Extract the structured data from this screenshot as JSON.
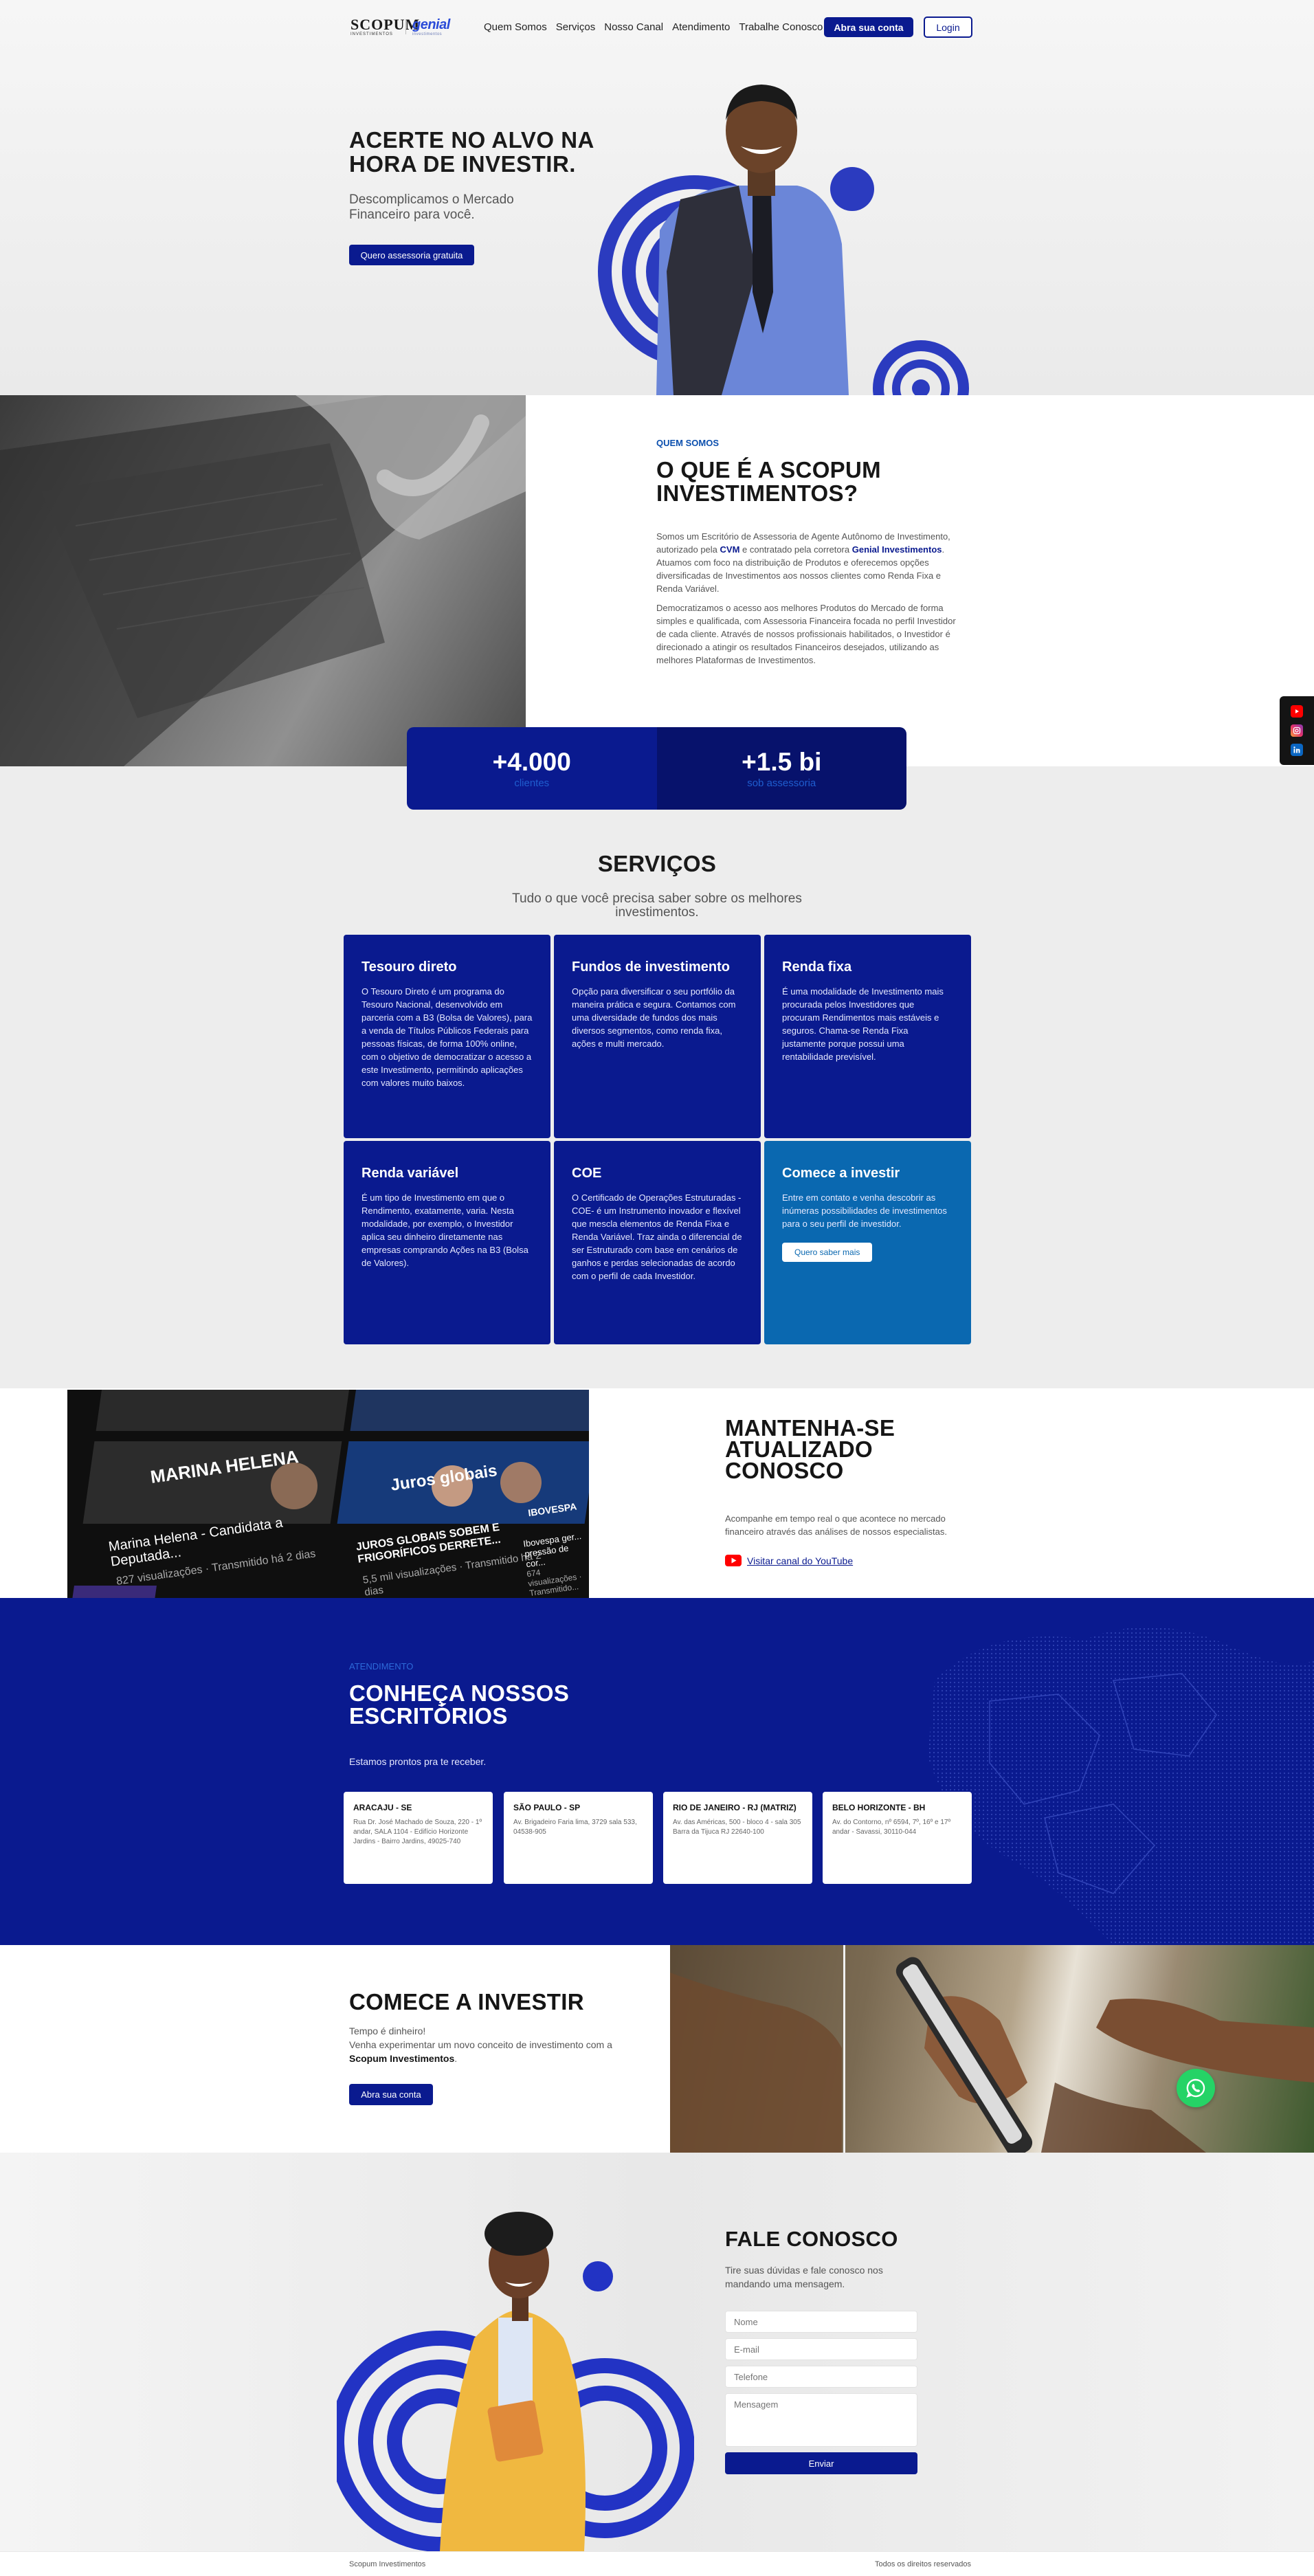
{
  "header": {
    "logo_scopum": "SCOPUM",
    "logo_scopum_sub": "INVESTIMENTOS",
    "logo_genial": "genial",
    "logo_genial_sub": "investimentos",
    "nav": [
      "Quem Somos",
      "Serviços",
      "Nosso Canal",
      "Atendimento",
      "Trabalhe Conosco"
    ],
    "open_account": "Abra sua conta",
    "login": "Login"
  },
  "hero": {
    "title_pre": "ACERTE NO ",
    "title_bold": "ALVO",
    "title_post": " NA HORA DE INVESTIR.",
    "subtitle": "Descomplicamos o Mercado Financeiro para você.",
    "cta": "Quero assessoria gratuita"
  },
  "about": {
    "eyebrow": "QUEM SOMOS",
    "title": "O QUE É A SCOPUM INVESTIMENTOS?",
    "p1_a": "Somos um Escritório de Assessoria de Agente Autônomo de Investimento, autorizado pela ",
    "p1_cvm": "CVM",
    "p1_b": " e contratado pela corretora ",
    "p1_genial": "Genial Investimentos",
    "p1_c": ". Atuamos com foco na distribuição de Produtos e oferecemos opções diversificadas de Investimentos aos nossos clientes como Renda Fixa e Renda Variável.",
    "p2": "Democratizamos o acesso aos melhores Produtos do Mercado de forma simples e qualificada, com Assessoria Financeira focada no perfil Investidor de cada cliente. Através de nossos profissionais habilitados, o Investidor é direcionado a atingir os resultados Financeiros desejados, utilizando as melhores Plataformas de Investimentos."
  },
  "stats": [
    {
      "value": "+4.000",
      "label": "clientes"
    },
    {
      "value": "+1.5 bi",
      "label": "sob assessoria"
    }
  ],
  "services": {
    "title": "SERVIÇOS",
    "subtitle": "Tudo o que você precisa saber sobre os melhores investimentos.",
    "cards": [
      {
        "title": "Tesouro direto",
        "text": "O Tesouro Direto é um programa do Tesouro Nacional, desenvolvido em parceria com a B3 (Bolsa de Valores), para a venda de Títulos Públicos Federais para pessoas físicas, de forma 100% online, com o objetivo de democratizar o acesso a este Investimento, permitindo aplicações com valores muito baixos."
      },
      {
        "title": "Fundos de investimento",
        "text": "Opção para diversificar o seu portfólio da maneira prática e segura. Contamos com uma diversidade de fundos dos mais diversos segmentos, como renda fixa, ações e multi mercado."
      },
      {
        "title": "Renda fixa",
        "text": "É uma modalidade de Investimento mais procurada pelos Investidores que procuram Rendimentos mais estáveis e seguros. Chama-se Renda Fixa justamente porque possui uma rentabilidade previsível."
      },
      {
        "title": "Renda variável",
        "text": "É um tipo de Investimento em que o Rendimento, exatamente, varia. Nesta modalidade, por exemplo, o Investidor aplica seu dinheiro diretamente nas empresas comprando Ações na B3 (Bolsa de Valores)."
      },
      {
        "title": "COE",
        "text": "O Certificado de Operações Estruturadas -COE- é um Instrumento inovador e flexível que mescla elementos de Renda Fixa e Renda Variável. Traz ainda o diferencial de ser Estruturado com base em cenários de ganhos e perdas selecionadas de acordo com o perfil de cada Investidor."
      },
      {
        "title": "Comece a investir",
        "text": "Entre em contato e venha descobrir as inúmeras possibilidades de investimentos para o seu perfil de investidor.",
        "button": "Quero saber mais"
      }
    ]
  },
  "youtube": {
    "title": "MANTENHA-SE ATUALIZADO CONOSCO",
    "text": "Acompanhe em tempo real o que acontece no mercado financeiro através das análises de nossos especialistas.",
    "link": "Visitar canal do YouTube",
    "thumbs": [
      {
        "title": "Marina Helena - Candidata a Deputada...",
        "meta": "827 visualizações · Transmitido há 2 dias",
        "overlay": "MARINA HELENA"
      },
      {
        "title": "JUROS GLOBAIS SOBEM E FRIGORÍFICOS DERRETE...",
        "meta": "5,5 mil visualizações · Transmitido há 2 dias",
        "overlay": "Juros globais"
      },
      {
        "title": "Ibovespa ger... pressão de cor...",
        "meta": "674 visualizações · Transmitido...",
        "overlay": "IBOVESPA"
      }
    ]
  },
  "offices": {
    "eyebrow": "ATENDIMENTO",
    "title": "CONHEÇA NOSSOS ESCRITÓRIOS",
    "subtitle": "Estamos prontos pra te receber.",
    "list": [
      {
        "name": "ARACAJU - SE",
        "address": "Rua Dr. José Machado de Souza, 220 - 1º andar, SALA 1104 - Edifício Horizonte Jardins - Bairro Jardins, 49025-740"
      },
      {
        "name": "SÃO PAULO - SP",
        "address": "Av. Brigadeiro Faria lima, 3729 sala 533, 04538-905"
      },
      {
        "name": "RIO DE JANEIRO - RJ (MATRIZ)",
        "address": "Av. das Américas, 500 - bloco 4 - sala 305 Barra da Tijuca RJ 22640-100"
      },
      {
        "name": "BELO HORIZONTE - BH",
        "address": "Av. do Contorno, nº 6594, 7º, 16º e 17º andar - Savassi, 30110-044"
      }
    ]
  },
  "start": {
    "title": "COMECE A INVESTIR",
    "line1": "Tempo é dinheiro!",
    "line2_a": "Venha experimentar um novo conceito de investimento com a ",
    "line2_b": "Scopum Investimentos",
    "line2_c": ".",
    "cta": "Abra sua conta"
  },
  "contact": {
    "title": "FALE CONOSCO",
    "text": "Tire suas dúvidas e fale conosco nos mandando uma mensagem.",
    "name_ph": "Nome",
    "email_ph": "E-mail",
    "phone_ph": "Telefone",
    "message_ph": "Mensagem",
    "submit": "Enviar"
  },
  "footer": {
    "left": "Scopum Investimentos",
    "right": "Todos os direitos reservados"
  },
  "colors": {
    "brand_blue": "#0a1a8f",
    "accent_blue": "#0a68b0",
    "youtube_red": "#ff0000",
    "whatsapp_green": "#25d366"
  }
}
